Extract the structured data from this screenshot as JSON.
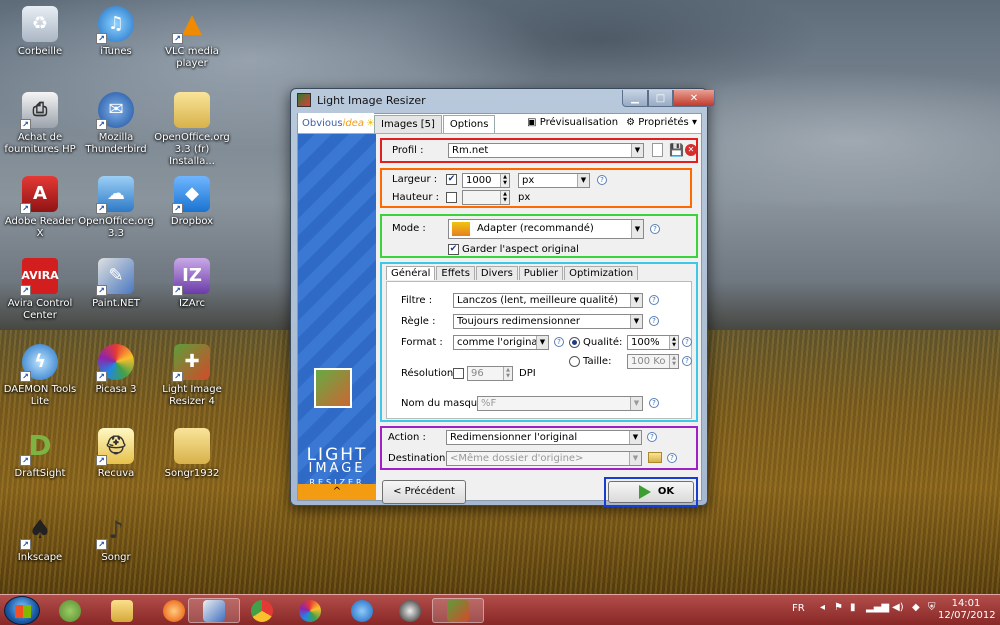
{
  "desktop": {
    "icons": [
      {
        "label": "Corbeille",
        "icon": "recycle-bin-icon"
      },
      {
        "label": "iTunes",
        "icon": "itunes-icon"
      },
      {
        "label": "VLC media player",
        "icon": "vlc-icon"
      },
      {
        "label": "Achat de fournitures HP",
        "icon": "hp-printer-icon"
      },
      {
        "label": "Mozilla Thunderbird",
        "icon": "thunderbird-icon"
      },
      {
        "label": "OpenOffice.org 3.3 (fr) Installa...",
        "icon": "folder-icon"
      },
      {
        "label": "Adobe Reader X",
        "icon": "adobe-reader-icon"
      },
      {
        "label": "OpenOffice.org 3.3",
        "icon": "openoffice-icon"
      },
      {
        "label": "Dropbox",
        "icon": "dropbox-icon"
      },
      {
        "label": "Avira Control Center",
        "icon": "avira-icon"
      },
      {
        "label": "Paint.NET",
        "icon": "paintnet-icon"
      },
      {
        "label": "IZArc",
        "icon": "izarc-icon"
      },
      {
        "label": "DAEMON Tools Lite",
        "icon": "daemon-tools-icon"
      },
      {
        "label": "Picasa 3",
        "icon": "picasa-icon"
      },
      {
        "label": "Light Image Resizer 4",
        "icon": "light-image-resizer-icon"
      },
      {
        "label": "DraftSight",
        "icon": "draftsight-icon"
      },
      {
        "label": "Recuva",
        "icon": "recuva-icon"
      },
      {
        "label": "Songr1932",
        "icon": "folder-icon"
      },
      {
        "label": "Inkscape",
        "icon": "inkscape-icon"
      },
      {
        "label": "Songr",
        "icon": "songr-icon"
      }
    ]
  },
  "window": {
    "title": "Light Image Resizer",
    "logo_part1": "Obvious",
    "logo_part2": "idea",
    "tabs": [
      "Images [5]",
      "Options"
    ],
    "preview_label": "Prévisualisation",
    "properties_label": "Propriétés",
    "brand_line1": "LIGHT",
    "brand_line2": "IMAGE",
    "brand_line3": "RESIZER",
    "collapse_glyph": "^"
  },
  "options": {
    "profil_label": "Profil :",
    "profil_value": "Rm.net",
    "largeur_label": "Largeur :",
    "largeur_value": "1000",
    "largeur_unit": "px",
    "hauteur_label": "Hauteur :",
    "hauteur_unit": "px",
    "mode_label": "Mode :",
    "mode_value": "Adapter (recommandé)",
    "keep_aspect_label": "Garder l'aspect original",
    "subtabs": [
      "Général",
      "Effets",
      "Divers",
      "Publier",
      "Optimization"
    ],
    "filtre_label": "Filtre :",
    "filtre_value": "Lanczos  (lent, meilleure qualité)",
    "regle_label": "Règle :",
    "regle_value": "Toujours redimensionner",
    "format_label": "Format :",
    "format_value": "comme l'original",
    "qualite_label": "Qualité:",
    "qualite_value": "100%",
    "taille_label": "Taille:",
    "taille_value": "100 Ko",
    "resolution_label": "Résolution :",
    "resolution_value": "96",
    "resolution_unit": "DPI",
    "masque_label": "Nom du masque :",
    "masque_value": "%F",
    "action_label": "Action :",
    "action_value": "Redimensionner l'original",
    "destination_label": "Destination :",
    "destination_placeholder": "<Même dossier d'origine>",
    "prev_button": "< Précédent",
    "ok_button": "OK"
  },
  "taskbar": {
    "language": "FR",
    "time": "14:01",
    "date": "12/07/2012"
  },
  "colors": {
    "box_profil": "#e02020",
    "box_size": "#ff6a00",
    "box_mode": "#3cd23c",
    "box_general": "#3cc8e6",
    "box_action": "#a020c8",
    "box_ok": "#1a3ccf"
  }
}
